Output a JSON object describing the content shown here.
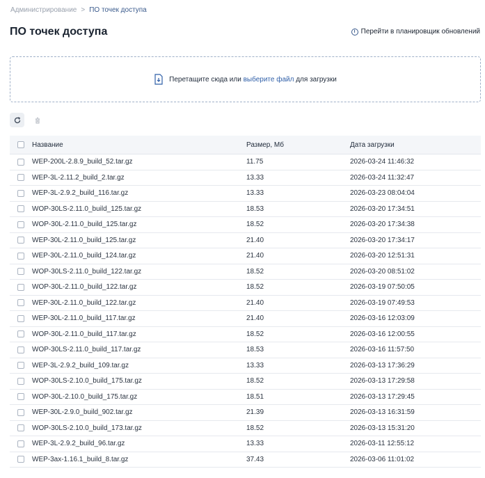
{
  "breadcrumb": {
    "parent": "Администрирование",
    "separator": ">",
    "current": "ПО точек доступа"
  },
  "page_title": "ПО точек доступа",
  "scheduler_link": "Перейти в планировщик обновлений",
  "dropzone": {
    "text_before": "Перетащите сюда или",
    "link": "выберите файл",
    "text_after": "для загрузки"
  },
  "toolbar": {
    "refresh_icon": "refresh-icon",
    "delete_icon": "trash-icon"
  },
  "table": {
    "headers": {
      "name": "Название",
      "size": "Размер, Мб",
      "date": "Дата загрузки"
    },
    "rows": [
      {
        "name": "WEP-200L-2.8.9_build_52.tar.gz",
        "size": "11.75",
        "date": "2026-03-24 11:46:32"
      },
      {
        "name": "WEP-3L-2.11.2_build_2.tar.gz",
        "size": "13.33",
        "date": "2026-03-24 11:32:47"
      },
      {
        "name": "WEP-3L-2.9.2_build_116.tar.gz",
        "size": "13.33",
        "date": "2026-03-23 08:04:04"
      },
      {
        "name": "WOP-30LS-2.11.0_build_125.tar.gz",
        "size": "18.53",
        "date": "2026-03-20 17:34:51"
      },
      {
        "name": "WOP-30L-2.11.0_build_125.tar.gz",
        "size": "18.52",
        "date": "2026-03-20 17:34:38"
      },
      {
        "name": "WEP-30L-2.11.0_build_125.tar.gz",
        "size": "21.40",
        "date": "2026-03-20 17:34:17"
      },
      {
        "name": "WEP-30L-2.11.0_build_124.tar.gz",
        "size": "21.40",
        "date": "2026-03-20 12:51:31"
      },
      {
        "name": "WOP-30LS-2.11.0_build_122.tar.gz",
        "size": "18.52",
        "date": "2026-03-20 08:51:02"
      },
      {
        "name": "WOP-30L-2.11.0_build_122.tar.gz",
        "size": "18.52",
        "date": "2026-03-19 07:50:05"
      },
      {
        "name": "WEP-30L-2.11.0_build_122.tar.gz",
        "size": "21.40",
        "date": "2026-03-19 07:49:53"
      },
      {
        "name": "WEP-30L-2.11.0_build_117.tar.gz",
        "size": "21.40",
        "date": "2026-03-16 12:03:09"
      },
      {
        "name": "WOP-30L-2.11.0_build_117.tar.gz",
        "size": "18.52",
        "date": "2026-03-16 12:00:55"
      },
      {
        "name": "WOP-30LS-2.11.0_build_117.tar.gz",
        "size": "18.53",
        "date": "2026-03-16 11:57:50"
      },
      {
        "name": "WEP-3L-2.9.2_build_109.tar.gz",
        "size": "13.33",
        "date": "2026-03-13 17:36:29"
      },
      {
        "name": "WOP-30LS-2.10.0_build_175.tar.gz",
        "size": "18.52",
        "date": "2026-03-13 17:29:58"
      },
      {
        "name": "WOP-30L-2.10.0_build_175.tar.gz",
        "size": "18.51",
        "date": "2026-03-13 17:29:45"
      },
      {
        "name": "WEP-30L-2.9.0_build_902.tar.gz",
        "size": "21.39",
        "date": "2026-03-13 16:31:59"
      },
      {
        "name": "WOP-30LS-2.10.0_build_173.tar.gz",
        "size": "18.52",
        "date": "2026-03-13 15:31:20"
      },
      {
        "name": "WEP-3L-2.9.2_build_96.tar.gz",
        "size": "13.33",
        "date": "2026-03-11 12:55:12"
      },
      {
        "name": "WEP-3ax-1.16.1_build_8.tar.gz",
        "size": "37.43",
        "date": "2026-03-06 11:01:02"
      }
    ]
  },
  "colors": {
    "accent": "#2f5fa8",
    "title": "#1a2330",
    "muted": "#9aa2ae",
    "header_bg": "#f4f6f9"
  }
}
